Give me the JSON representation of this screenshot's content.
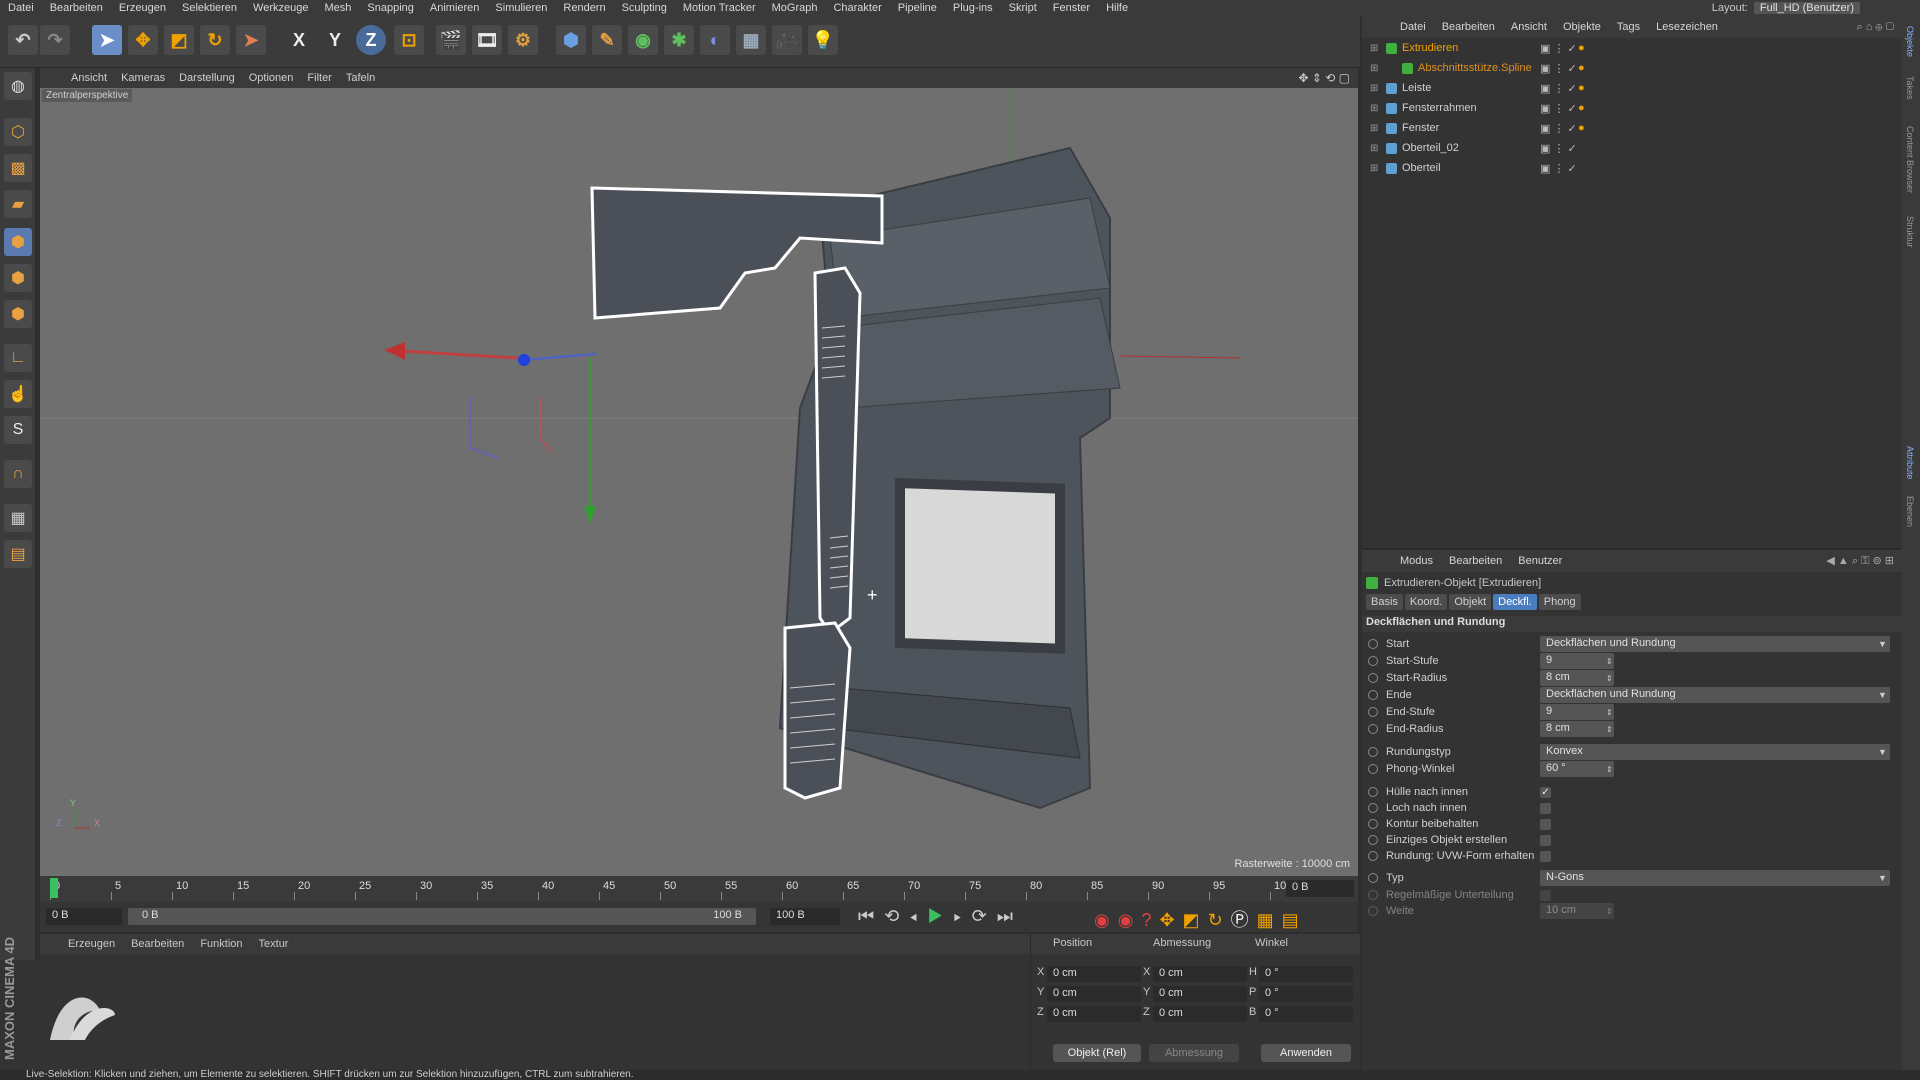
{
  "menubar": {
    "items": [
      "Datei",
      "Bearbeiten",
      "Erzeugen",
      "Selektieren",
      "Werkzeuge",
      "Mesh",
      "Snapping",
      "Animieren",
      "Simulieren",
      "Rendern",
      "Sculpting",
      "Motion Tracker",
      "MoGraph",
      "Charakter",
      "Pipeline",
      "Plug-ins",
      "Skript",
      "Fenster",
      "Hilfe"
    ],
    "layout_label": "Layout:",
    "layout_value": "Full_HD (Benutzer)"
  },
  "toolbar": {
    "axis_x": "X",
    "axis_y": "Y",
    "axis_z": "Z"
  },
  "viewport": {
    "menu": [
      "Ansicht",
      "Kameras",
      "Darstellung",
      "Optionen",
      "Filter",
      "Tafeln"
    ],
    "title": "Zentralperspektive",
    "raster": "Rasterweite : 10000 cm",
    "axis_y": "Y",
    "axis_z": "Z",
    "axis_x": "X"
  },
  "timeline": {
    "ticks": [
      "0",
      "5",
      "10",
      "15",
      "20",
      "25",
      "30",
      "35",
      "40",
      "45",
      "50",
      "55",
      "60",
      "65",
      "70",
      "75",
      "80",
      "85",
      "90",
      "95",
      "100"
    ],
    "frame_end_field": "0 B",
    "start_field": "0 B",
    "slider_start": "0 B",
    "slider_end": "100 B",
    "end_field": "100 B"
  },
  "material_manager": {
    "menu": [
      "Erzeugen",
      "Bearbeiten",
      "Funktion",
      "Textur"
    ],
    "brand": "MAXON CINEMA 4D"
  },
  "coordinates": {
    "headers": [
      "Position",
      "Abmessung",
      "Winkel"
    ],
    "rows": [
      {
        "a": "X",
        "pos": "0 cm",
        "b": "X",
        "size": "0 cm",
        "c": "H",
        "rot": "0 °"
      },
      {
        "a": "Y",
        "pos": "0 cm",
        "b": "Y",
        "size": "0 cm",
        "c": "P",
        "rot": "0 °"
      },
      {
        "a": "Z",
        "pos": "0 cm",
        "b": "Z",
        "size": "0 cm",
        "c": "B",
        "rot": "0 °"
      }
    ],
    "mode": "Objekt (Rel)",
    "size_mode": "Abmessung",
    "apply": "Anwenden"
  },
  "status": "Live-Selektion: Klicken und ziehen, um Elemente zu selektieren. SHIFT drücken um zur Selektion hinzuzufügen, CTRL zum subtrahieren.",
  "object_manager": {
    "menu": [
      "Datei",
      "Bearbeiten",
      "Ansicht",
      "Objekte",
      "Tags",
      "Lesezeichen"
    ],
    "objects": [
      {
        "name": "Extrudieren",
        "color": "#f0a000"
      },
      {
        "name": "Abschnittsstütze.Spline",
        "color": "#e09020"
      },
      {
        "name": "Leiste",
        "color": "#d0d0d0"
      },
      {
        "name": "Fensterrahmen",
        "color": "#d0d0d0"
      },
      {
        "name": "Fenster",
        "color": "#d0d0d0"
      },
      {
        "name": "Oberteil_02",
        "color": "#d0d0d0"
      },
      {
        "name": "Oberteil",
        "color": "#d0d0d0"
      }
    ]
  },
  "attribute_manager": {
    "menu": [
      "Modus",
      "Bearbeiten",
      "Benutzer"
    ],
    "object_title": "Extrudieren-Objekt [Extrudieren]",
    "tabs": [
      "Basis",
      "Koord.",
      "Objekt",
      "Deckfl.",
      "Phong"
    ],
    "active_tab": "Deckfl.",
    "section": "Deckflächen und Rundung",
    "fields": [
      {
        "label": "Start",
        "value": "Deckflächen und Rundung",
        "type": "dropdown"
      },
      {
        "label": "Start-Stufe",
        "value": "9",
        "type": "number"
      },
      {
        "label": "Start-Radius",
        "value": "8 cm",
        "type": "number"
      },
      {
        "label": "Ende",
        "value": "Deckflächen und Rundung",
        "type": "dropdown"
      },
      {
        "label": "End-Stufe",
        "value": "9",
        "type": "number"
      },
      {
        "label": "End-Radius",
        "value": "8 cm",
        "type": "number"
      },
      {
        "label": "Rundungstyp",
        "value": "Konvex",
        "type": "dropdown"
      },
      {
        "label": "Phong-Winkel",
        "value": "60 °",
        "type": "number"
      },
      {
        "label": "Hülle nach innen",
        "value": "✓",
        "type": "check"
      },
      {
        "label": "Loch nach innen",
        "value": "",
        "type": "check"
      },
      {
        "label": "Kontur beibehalten",
        "value": "",
        "type": "check"
      },
      {
        "label": "Einziges Objekt erstellen",
        "value": "",
        "type": "check"
      },
      {
        "label": "Rundung: UVW-Form erhalten",
        "value": "",
        "type": "check"
      },
      {
        "label": "Typ",
        "value": "N-Gons",
        "type": "dropdown"
      },
      {
        "label": "Regelmäßige Unterteilung",
        "value": "",
        "type": "check"
      },
      {
        "label": "Weite",
        "value": "10 cm",
        "type": "number"
      }
    ]
  },
  "side_tabs": [
    "Objekte",
    "Takes",
    "Content Browser",
    "Struktur",
    "Attribute",
    "Ebenen"
  ],
  "colors": {
    "accent": "#4a7dbf",
    "orange": "#f0a000"
  }
}
